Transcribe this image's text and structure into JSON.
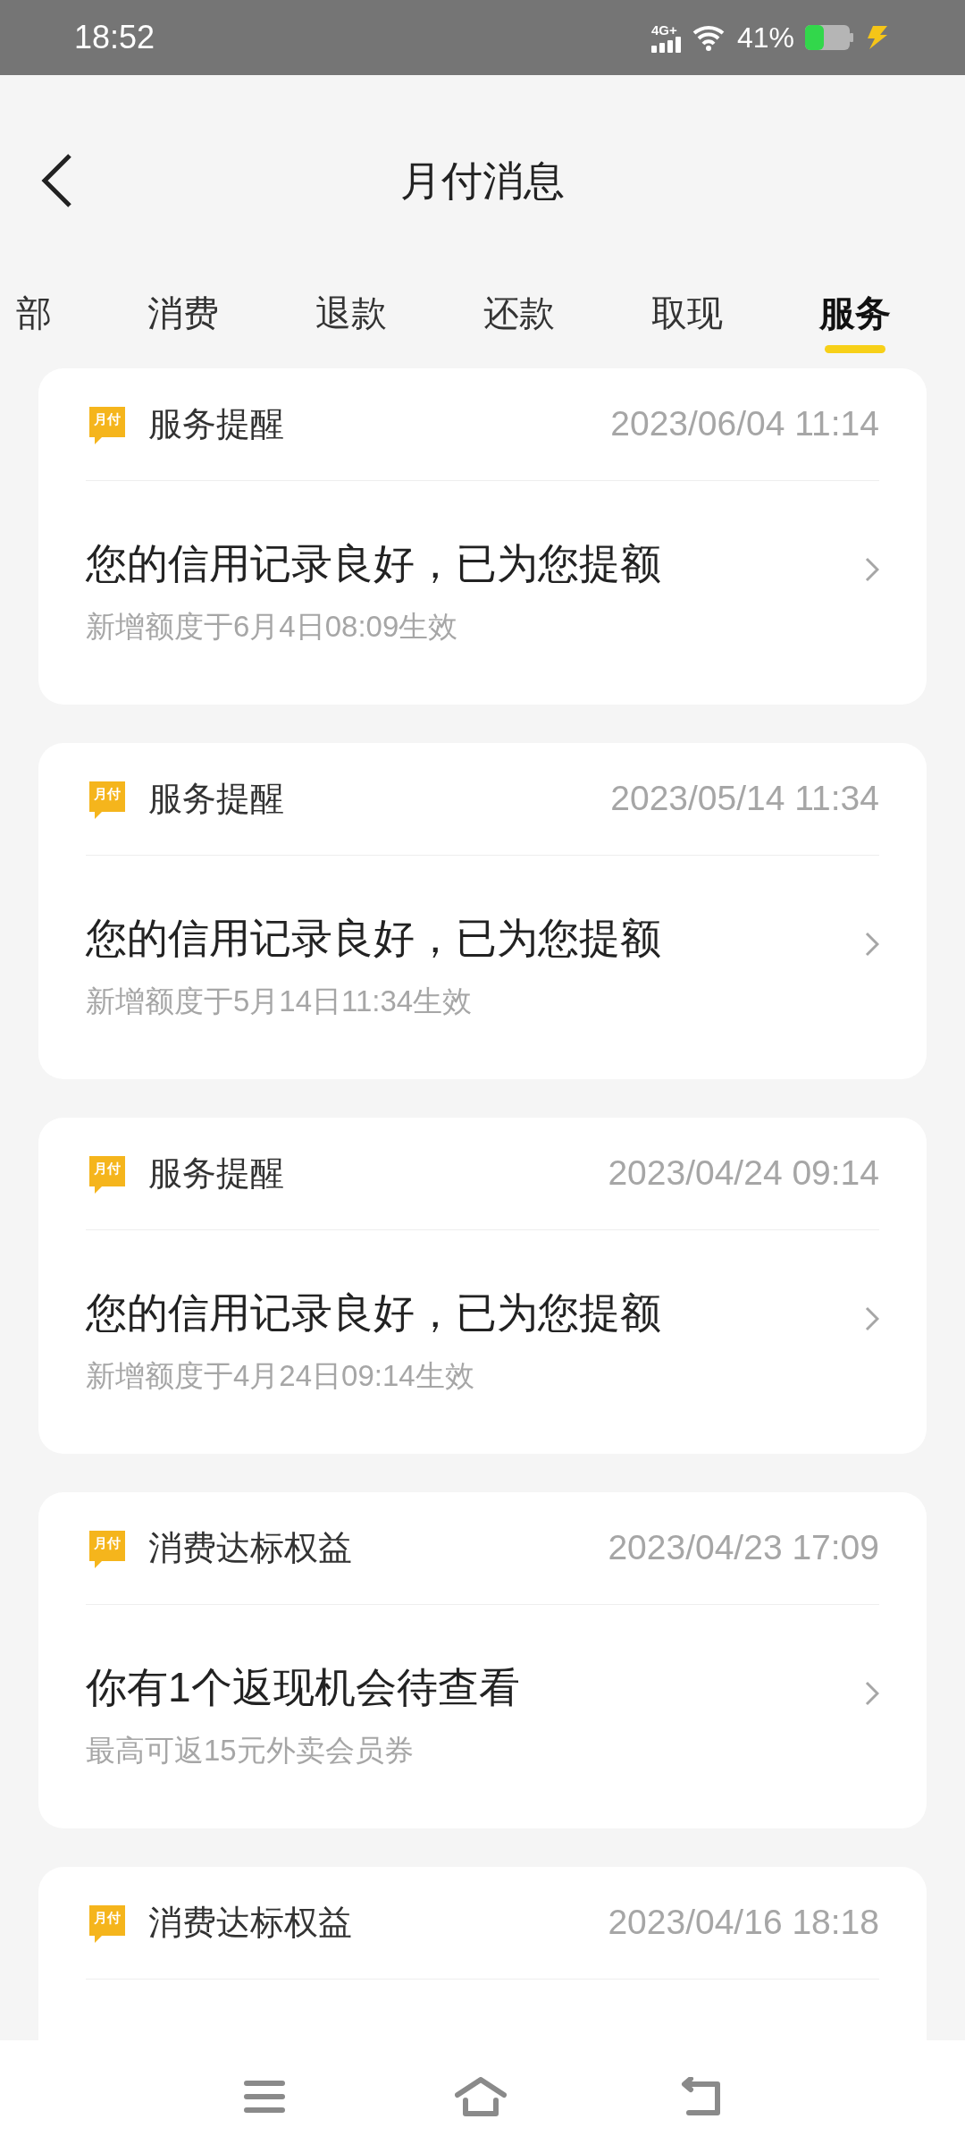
{
  "status_bar": {
    "time": "18:52",
    "network": "4G+",
    "battery": "41%",
    "charging": true
  },
  "header": {
    "title": "月付消息"
  },
  "tabs": [
    {
      "label": "部",
      "selected": false
    },
    {
      "label": "消费",
      "selected": false
    },
    {
      "label": "退款",
      "selected": false
    },
    {
      "label": "还款",
      "selected": false
    },
    {
      "label": "取现",
      "selected": false
    },
    {
      "label": "服务",
      "selected": true
    }
  ],
  "messages": [
    {
      "badge": "月付",
      "title": "服务提醒",
      "time": "2023/06/04 11:14",
      "message": "您的信用记录良好，已为您提额",
      "detail": "新增额度于6月4日08:09生效"
    },
    {
      "badge": "月付",
      "title": "服务提醒",
      "time": "2023/05/14 11:34",
      "message": "您的信用记录良好，已为您提额",
      "detail": "新增额度于5月14日11:34生效"
    },
    {
      "badge": "月付",
      "title": "服务提醒",
      "time": "2023/04/24 09:14",
      "message": "您的信用记录良好，已为您提额",
      "detail": "新增额度于4月24日09:14生效"
    },
    {
      "badge": "月付",
      "title": "消费达标权益",
      "time": "2023/04/23 17:09",
      "message": "你有1个返现机会待查看",
      "detail": "最高可返15元外卖会员券"
    },
    {
      "badge": "月付",
      "title": "消费达标权益",
      "time": "2023/04/16 18:18"
    }
  ]
}
